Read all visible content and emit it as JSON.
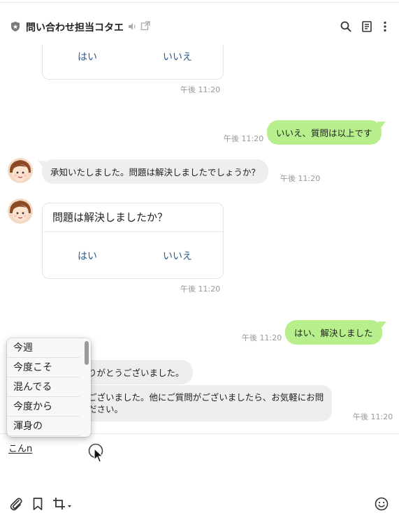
{
  "header": {
    "title": "問い合わせ担当コタエ",
    "icons": [
      "shield-icon",
      "speaker-icon",
      "popout-icon",
      "search-icon",
      "notes-icon",
      "more-icon"
    ]
  },
  "messages": {
    "card1": {
      "yes": "はい",
      "no": "いいえ",
      "time": "午後 11:20"
    },
    "me1": {
      "text": "いいえ、質問は以上です",
      "time": "午後 11:20"
    },
    "bot1": {
      "text": "承知いたしました。問題は解決しましたでしょうか？",
      "time": "午後 11:20"
    },
    "card2": {
      "question": "問題は解決しましたか？",
      "yes": "はい",
      "no": "いいえ",
      "time": "午後 11:20"
    },
    "me2": {
      "text": "はい、解決しました",
      "time": "午後 11:20"
    },
    "bot2": {
      "text": "りがとうございました。"
    },
    "bot3": {
      "line1": "ございました。他にご質問がございましたら、お気軽にお問",
      "line2": "ださい。",
      "time": "午後 11:20"
    }
  },
  "ime": {
    "candidates": [
      "今週",
      "今度こそ",
      "混んでる",
      "今度から",
      "渾身の"
    ]
  },
  "input": {
    "composing": "こんn"
  },
  "colors": {
    "my_bubble": "#b7ef8c",
    "other_bubble": "#eeeeee",
    "link": "#2c5a8c"
  }
}
